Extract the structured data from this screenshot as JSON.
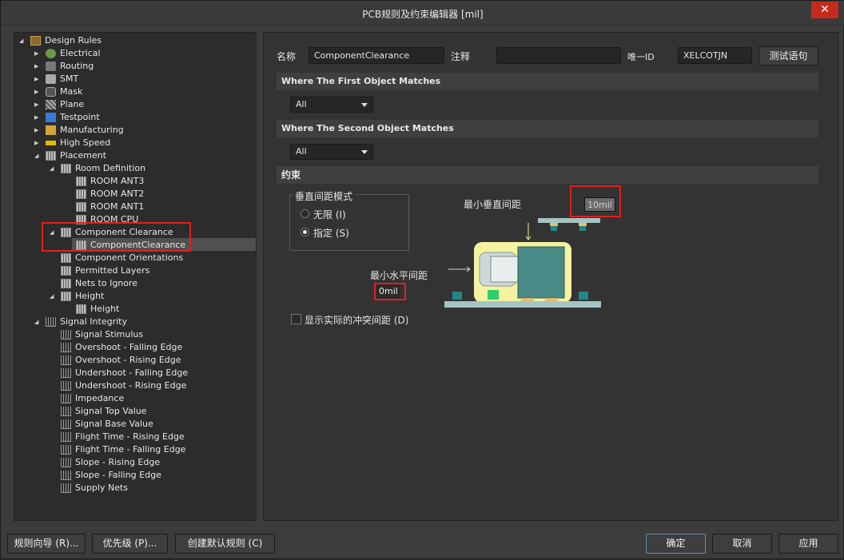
{
  "window": {
    "title": "PCB规则及约束编辑器 [mil]",
    "close_glyph": "✕"
  },
  "tree": {
    "root": "Design Rules",
    "categories": [
      "Electrical",
      "Routing",
      "SMT",
      "Mask",
      "Plane",
      "Testpoint",
      "Manufacturing",
      "High Speed",
      "Placement"
    ],
    "placement": {
      "room_definition": "Room Definition",
      "rooms": [
        "ROOM ANT3",
        "ROOM ANT2",
        "ROOM ANT1",
        "ROOM CPU"
      ],
      "component_clearance": "Component Clearance",
      "component_clearance_child": "ComponentClearance",
      "component_orientations": "Component Orientations",
      "permitted_layers": "Permitted Layers",
      "nets_to_ignore": "Nets to Ignore",
      "height": "Height",
      "height_child": "Height"
    },
    "signal_integrity": "Signal Integrity",
    "si_items": [
      "Signal Stimulus",
      "Overshoot - Falling Edge",
      "Overshoot - Rising Edge",
      "Undershoot - Falling Edge",
      "Undershoot - Rising Edge",
      "Impedance",
      "Signal Top Value",
      "Signal Base Value",
      "Flight Time - Rising Edge",
      "Flight Time - Falling Edge",
      "Slope - Rising Edge",
      "Slope - Falling Edge",
      "Supply Nets"
    ]
  },
  "rule": {
    "name_label": "名称",
    "name_value": "ComponentClearance",
    "comment_label": "注释",
    "comment_value": "",
    "uid_label": "唯一ID",
    "uid_value": "XELCOTJN",
    "test_button": "测试语句"
  },
  "first_match": {
    "title": "Where The First Object Matches",
    "value": "All"
  },
  "second_match": {
    "title": "Where The Second Object Matches",
    "value": "All"
  },
  "constraints": {
    "title": "约束",
    "vertical_mode_label": "垂直间距模式",
    "infinite_label": "无限 (I)",
    "specified_label": "指定 (S)",
    "selected_mode": "specified",
    "min_vertical_label": "最小垂直间距",
    "min_vertical_value": "10mil",
    "min_horizontal_label": "最小水平间距",
    "min_horizontal_value": "0mil",
    "show_actual_label": "显示实际的冲突间距 (D)"
  },
  "buttons": {
    "wizard": "规则向导 (R)...",
    "priority": "优先级 (P)...",
    "create_default": "创建默认规则 (C)",
    "ok": "确定",
    "cancel": "取消",
    "apply": "应用"
  },
  "colors": {
    "accent_red": "#e02020",
    "board": "#a7c4c4",
    "body": "#4a8a86",
    "halo": "#f5f2a0"
  }
}
